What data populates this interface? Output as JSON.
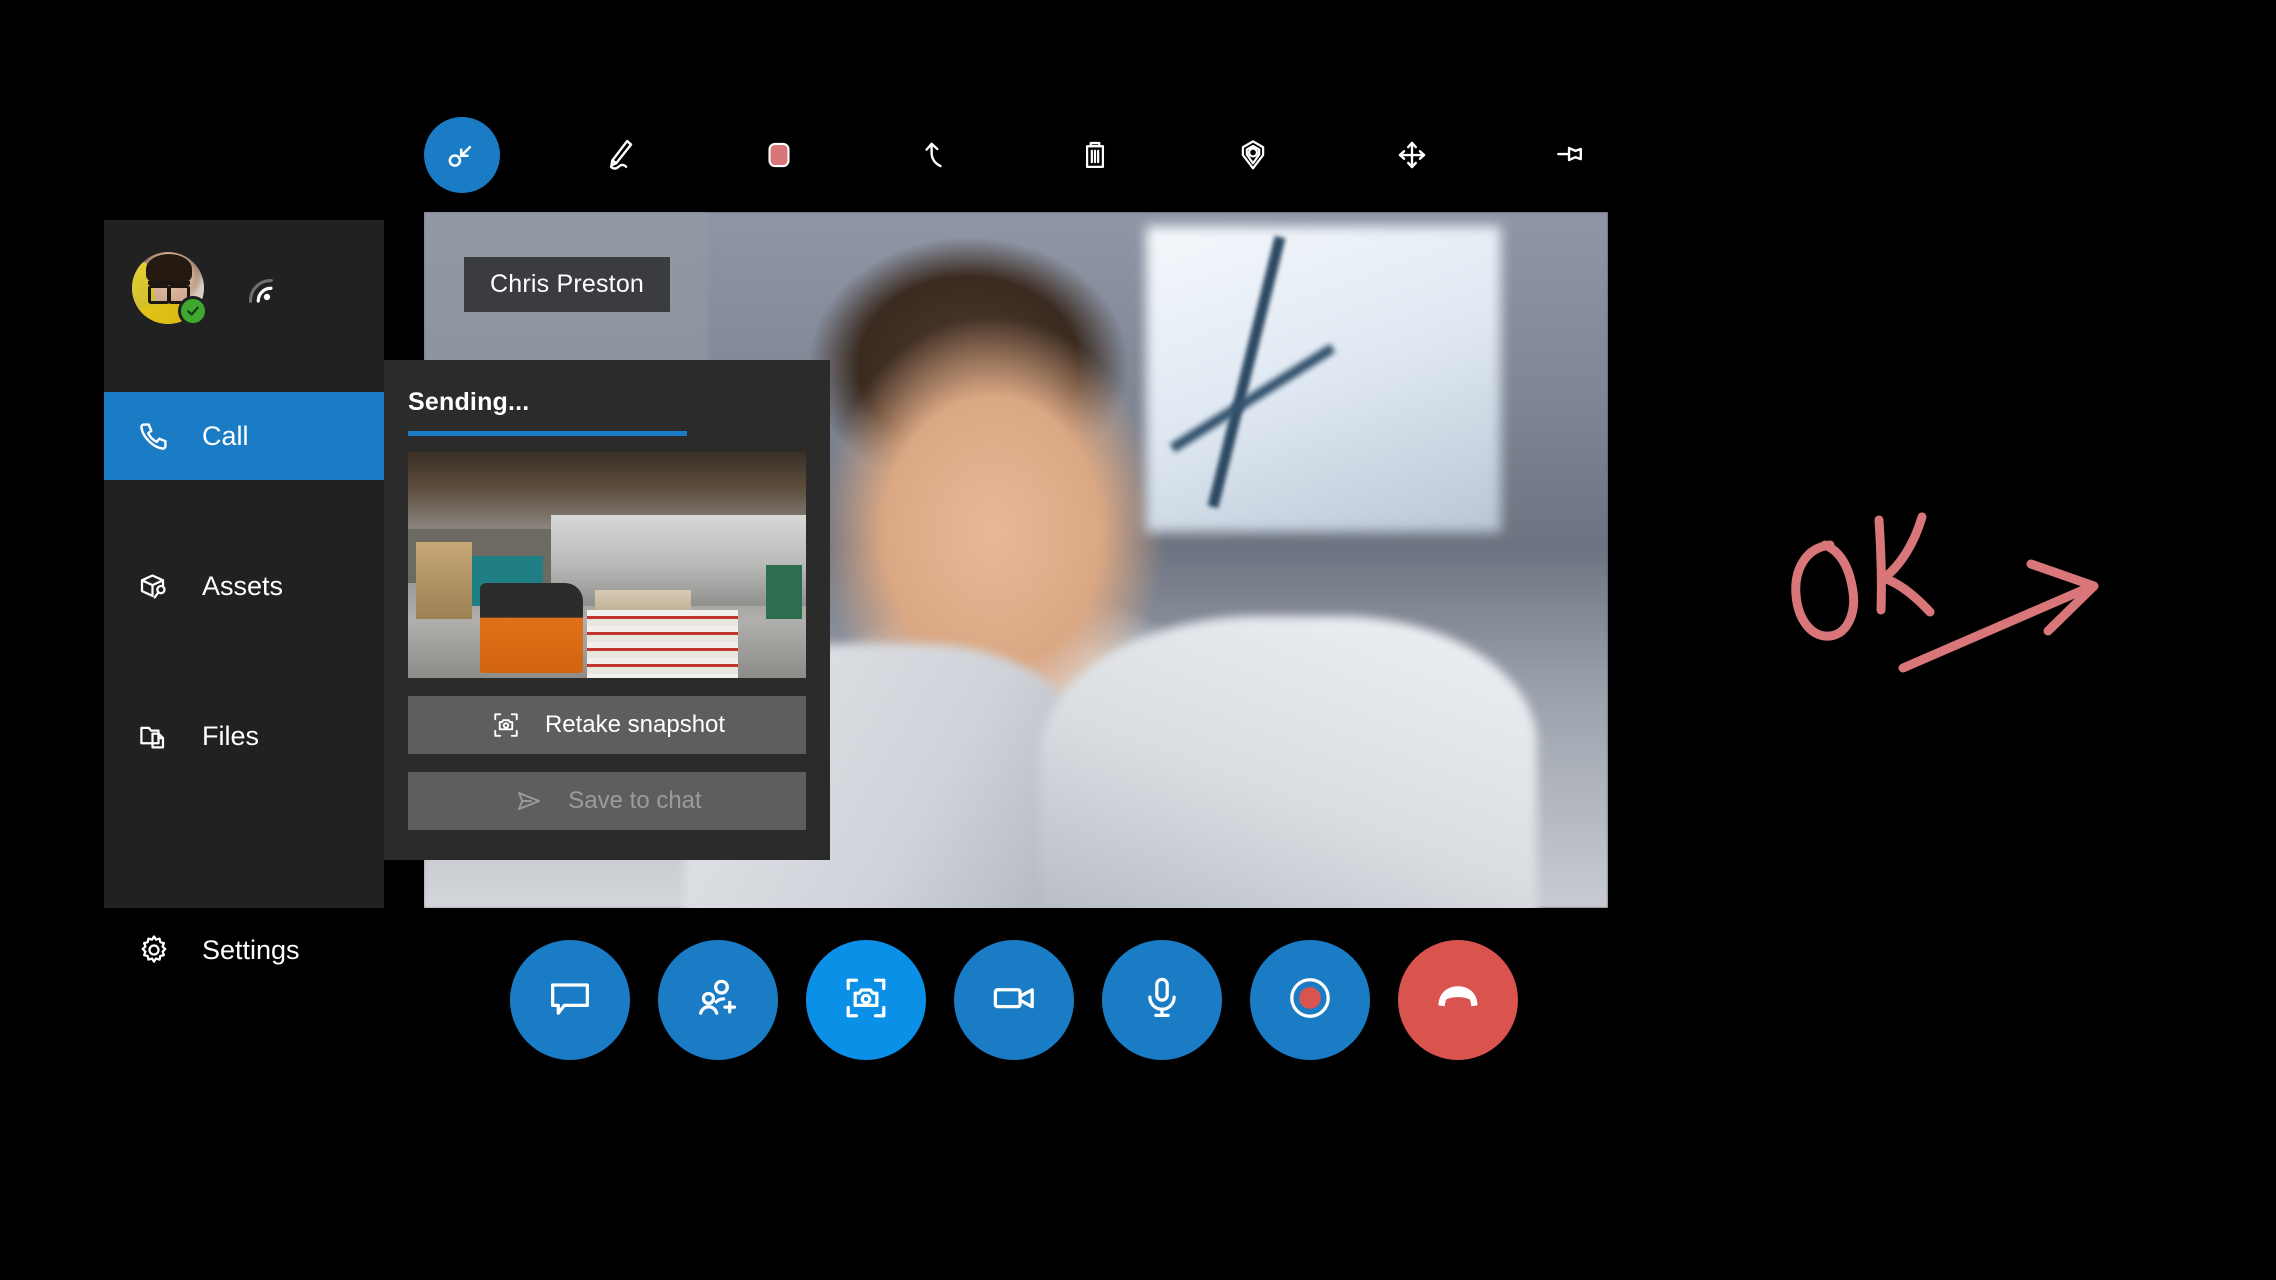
{
  "app": {
    "title": "Remote Assist Call",
    "accent_color": "#1a7cc4",
    "accent_bright": "#0a90e6",
    "danger_color": "#d9534f",
    "ink_color": "#d9767a",
    "panel_bg": "#2b2b2b",
    "sidebar_bg": "#212121"
  },
  "toolbar": {
    "items": [
      {
        "label": "Select",
        "icon": "select-cursor-icon",
        "active": true
      },
      {
        "label": "Ink",
        "icon": "pen-icon",
        "active": false
      },
      {
        "label": "Color",
        "icon": "color-swatch-icon",
        "active": false,
        "color": "#d9767a"
      },
      {
        "label": "Undo",
        "icon": "undo-icon",
        "active": false
      },
      {
        "label": "Delete all ink",
        "icon": "trash-icon",
        "active": false
      },
      {
        "label": "Place arrow",
        "icon": "location-pin-icon",
        "active": false
      },
      {
        "label": "Move",
        "icon": "move-arrows-icon",
        "active": false
      },
      {
        "label": "Pin",
        "icon": "pin-icon",
        "active": false
      }
    ]
  },
  "video": {
    "participant_name": "Chris Preston"
  },
  "sidebar": {
    "profile": {
      "avatar_alt": "User avatar",
      "presence": "available",
      "presence_icon": "check-badge-icon",
      "signal_icon": "signal-strength-icon"
    },
    "items": [
      {
        "label": "Call",
        "icon": "phone-icon",
        "active": true
      },
      {
        "label": "Assets",
        "icon": "box-wrench-icon",
        "active": false
      },
      {
        "label": "Files",
        "icon": "folder-file-icon",
        "active": false
      },
      {
        "label": "Settings",
        "icon": "gear-icon",
        "active": false
      }
    ]
  },
  "snapshot_panel": {
    "status": "Sending...",
    "progress_percent": 70,
    "thumbnail_alt": "Warehouse floor snapshot with pallet jack",
    "retake_button": {
      "label": "Retake snapshot",
      "icon": "camera-frame-icon",
      "enabled": true
    },
    "save_button": {
      "label": "Save to chat",
      "icon": "send-icon",
      "enabled": false
    }
  },
  "call_controls": [
    {
      "label": "Chat",
      "icon": "chat-bubble-icon",
      "style": "primary"
    },
    {
      "label": "Add people",
      "icon": "add-people-icon",
      "style": "primary"
    },
    {
      "label": "Take snapshot",
      "icon": "camera-frame-icon",
      "style": "bright"
    },
    {
      "label": "Video",
      "icon": "video-camera-icon",
      "style": "primary"
    },
    {
      "label": "Mute",
      "icon": "microphone-icon",
      "style": "primary"
    },
    {
      "label": "Record",
      "icon": "record-icon",
      "style": "primary"
    },
    {
      "label": "End call",
      "icon": "hang-up-icon",
      "style": "danger"
    }
  ],
  "annotation": {
    "text": "OK",
    "shape": "arrow",
    "color": "#d9767a"
  }
}
